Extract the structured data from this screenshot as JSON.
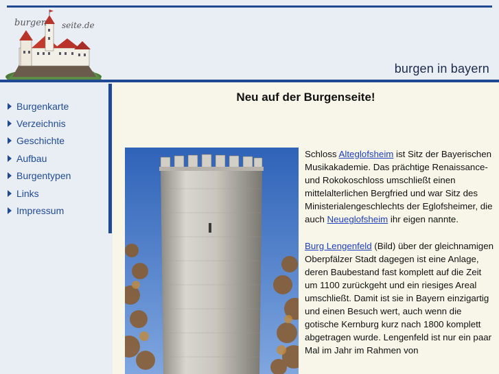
{
  "header": {
    "logo_left": "burgen",
    "logo_right": "seite.de",
    "site_title": "burgen in bayern"
  },
  "nav": {
    "items": [
      {
        "label": "Burgenkarte"
      },
      {
        "label": "Verzeichnis"
      },
      {
        "label": "Geschichte"
      },
      {
        "label": "Aufbau"
      },
      {
        "label": "Burgentypen"
      },
      {
        "label": "Links"
      },
      {
        "label": "Impressum"
      }
    ]
  },
  "main": {
    "headline": "Neu auf der Burgenseite!",
    "p1": {
      "t1": "Schloss ",
      "link1": "Alteglofsheim",
      "t2": " ist Sitz der Bayerischen Musikakademie. Das prächtige Renaissance- und Rokokoschloss umschließt einen mittelalterlichen Bergfried und war Sitz des Ministerialengeschlechts der Eglofsheimer, die auch ",
      "link2": "Neueglofsheim",
      "t3": " ihr eigen nannte."
    },
    "p2": {
      "link1": "Burg Lengenfeld",
      "t1": " (Bild) über der gleichnamigen Oberpfälzer Stadt dagegen ist eine Anlage, deren Baubestand fast komplett auf die Zeit um 1100 zurückgeht und ein riesiges Areal umschließt. Damit ist sie in Bayern einzigartig und einen Besuch wert, auch wenn die gotische Kernburg kurz nach 1800 komplett abgetragen wurde. Lengenfeld ist nur ein paar Mal im Jahr im Rahmen von"
    }
  },
  "colors": {
    "accent": "#1f4a93",
    "panel": "#e9eef5",
    "content_bg": "#f7f6e9",
    "link": "#1f3fbf"
  }
}
